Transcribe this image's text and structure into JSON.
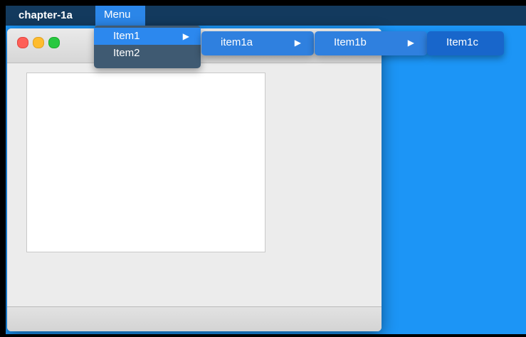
{
  "menubar": {
    "app_name": "chapter-1a",
    "menu_title": "Menu"
  },
  "menu": {
    "items": [
      {
        "label": "Item1",
        "arrow": "▶",
        "selected": true
      },
      {
        "label": "Item2",
        "arrow": "",
        "selected": false
      }
    ]
  },
  "submenus": [
    {
      "label": "item1a",
      "arrow": "▶"
    },
    {
      "label": "Item1b",
      "arrow": "▶"
    },
    {
      "label": "Item1c",
      "arrow": ""
    }
  ],
  "colors": {
    "desktop": "#1c95f6",
    "menubar": "#133a5e",
    "menu_highlight": "#2c88ee",
    "submenu": "#2f80df",
    "submenu_active": "#1866cb"
  },
  "icons": {
    "window_controls": [
      "close-icon",
      "minimize-icon",
      "maximize-icon"
    ],
    "submenu_indicator": "chevron-right-icon"
  }
}
